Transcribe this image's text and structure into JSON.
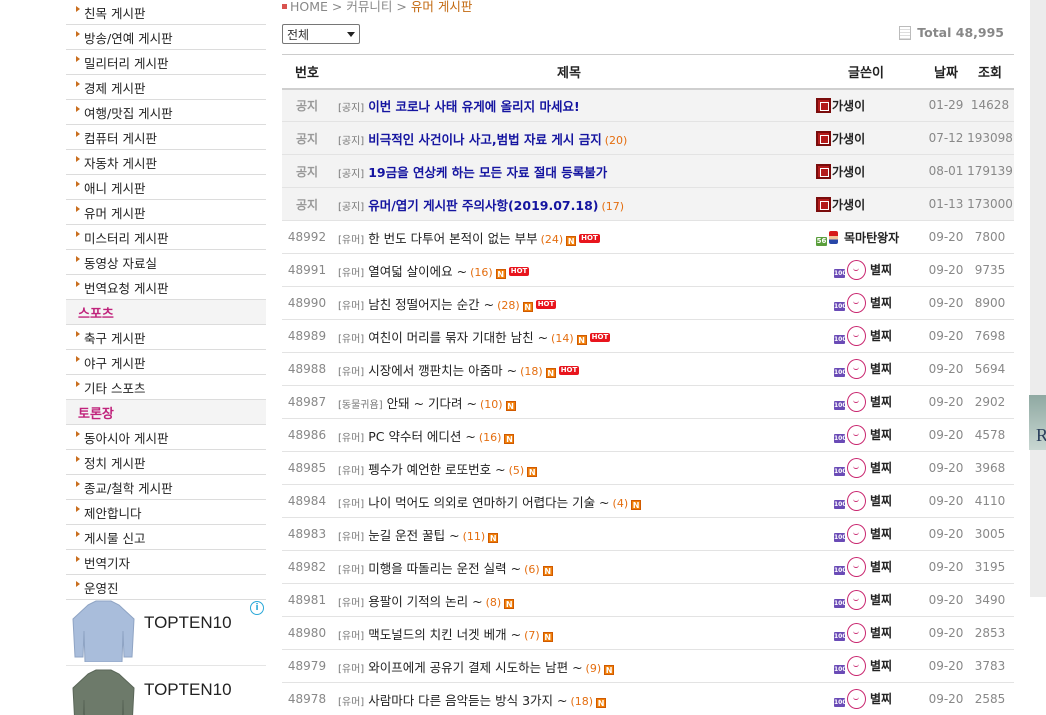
{
  "sidebar": {
    "items": [
      {
        "type": "item",
        "label": "친목 게시판"
      },
      {
        "type": "item",
        "label": "방송/연예 게시판"
      },
      {
        "type": "item",
        "label": "밀리터리 게시판"
      },
      {
        "type": "item",
        "label": "경제 게시판"
      },
      {
        "type": "item",
        "label": "여행/맛집 게시판"
      },
      {
        "type": "item",
        "label": "컴퓨터 게시판"
      },
      {
        "type": "item",
        "label": "자동차 게시판"
      },
      {
        "type": "item",
        "label": "애니 게시판"
      },
      {
        "type": "item",
        "label": "유머 게시판"
      },
      {
        "type": "item",
        "label": "미스터리 게시판"
      },
      {
        "type": "item",
        "label": "동영상 자료실"
      },
      {
        "type": "item",
        "label": "번역요청 게시판"
      },
      {
        "type": "category",
        "label": "스포츠"
      },
      {
        "type": "item",
        "label": "축구 게시판"
      },
      {
        "type": "item",
        "label": "야구 게시판"
      },
      {
        "type": "item",
        "label": "기타 스포츠"
      },
      {
        "type": "category",
        "label": "토론장"
      },
      {
        "type": "item",
        "label": "동아시아 게시판"
      },
      {
        "type": "item",
        "label": "정치 게시판"
      },
      {
        "type": "item",
        "label": "종교/철학 게시판"
      },
      {
        "type": "item",
        "label": "제안합니다"
      },
      {
        "type": "item",
        "label": "게시물 신고"
      },
      {
        "type": "item",
        "label": "번역기자"
      },
      {
        "type": "item",
        "label": "운영진"
      }
    ]
  },
  "ads": {
    "items": [
      {
        "label": "TOPTEN10",
        "color": "#a9bddb"
      },
      {
        "label": "TOPTEN10",
        "color": "#6d7a6a"
      }
    ]
  },
  "breadcrumb": {
    "home": "HOME",
    "section": "커뮤니티",
    "current": "유머 게시판",
    "separator": ">"
  },
  "filter": {
    "selected": "전체"
  },
  "total": {
    "label": "Total",
    "count": "48,995"
  },
  "table": {
    "headers": {
      "num": "번호",
      "subject": "제목",
      "author": "글쓴이",
      "date": "날짜",
      "views": "조회"
    },
    "rows": [
      {
        "num": "공지",
        "notice": true,
        "category": "[공지]",
        "title": "이번 코로나 사태 유게에 올리지 마세요!",
        "comments": "",
        "new": false,
        "hot": false,
        "author": "가생이",
        "author_icon": "admin-icon",
        "date": "01-29",
        "views": "14628"
      },
      {
        "num": "공지",
        "notice": true,
        "category": "[공지]",
        "title": "비극적인 사건이나 사고,범법 자료 게시 금지",
        "comments": "(20)",
        "new": false,
        "hot": false,
        "author": "가생이",
        "author_icon": "admin-icon",
        "date": "07-12",
        "views": "193098"
      },
      {
        "num": "공지",
        "notice": true,
        "category": "[공지]",
        "title": "19금을 연상케 하는 모든 자료 절대 등록불가",
        "comments": "",
        "new": false,
        "hot": false,
        "author": "가생이",
        "author_icon": "admin-icon",
        "date": "08-01",
        "views": "179139"
      },
      {
        "num": "공지",
        "notice": true,
        "category": "[공지]",
        "title": "유머/엽기 게시판 주의사항(2019.07.18)",
        "comments": "(17)",
        "new": false,
        "hot": false,
        "author": "가생이",
        "author_icon": "admin-icon",
        "date": "01-13",
        "views": "173000"
      },
      {
        "num": "48992",
        "notice": false,
        "category": "[유머]",
        "title": "한 번도 다투어 본적이 없는 부부",
        "comments": "(24)",
        "new": true,
        "hot": true,
        "author": "목마탄왕자",
        "author_icon": "mario-icon",
        "date": "09-20",
        "views": "7800"
      },
      {
        "num": "48991",
        "notice": false,
        "category": "[유머]",
        "title": "열여덟 살이에요 ~",
        "comments": "(16)",
        "new": true,
        "hot": true,
        "author": "별찌",
        "author_icon": "mascot-icon",
        "date": "09-20",
        "views": "9735"
      },
      {
        "num": "48990",
        "notice": false,
        "category": "[유머]",
        "title": "남친 정떨어지는 순간 ~",
        "comments": "(28)",
        "new": true,
        "hot": true,
        "author": "별찌",
        "author_icon": "mascot-icon",
        "date": "09-20",
        "views": "8900"
      },
      {
        "num": "48989",
        "notice": false,
        "category": "[유머]",
        "title": "여친이 머리를 묶자 기대한 남친 ~",
        "comments": "(14)",
        "new": true,
        "hot": true,
        "author": "별찌",
        "author_icon": "mascot-icon",
        "date": "09-20",
        "views": "7698"
      },
      {
        "num": "48988",
        "notice": false,
        "category": "[유머]",
        "title": "시장에서 깽판치는 아줌마 ~",
        "comments": "(18)",
        "new": true,
        "hot": true,
        "author": "별찌",
        "author_icon": "mascot-icon",
        "date": "09-20",
        "views": "5694"
      },
      {
        "num": "48987",
        "notice": false,
        "category": "[동물귀욤]",
        "title": "안돼 ~ 기다려 ~",
        "comments": "(10)",
        "new": true,
        "hot": false,
        "author": "별찌",
        "author_icon": "mascot-icon",
        "date": "09-20",
        "views": "2902"
      },
      {
        "num": "48986",
        "notice": false,
        "category": "[유머]",
        "title": "PC 약수터 에디션 ~",
        "comments": "(16)",
        "new": true,
        "hot": false,
        "author": "별찌",
        "author_icon": "mascot-icon",
        "date": "09-20",
        "views": "4578"
      },
      {
        "num": "48985",
        "notice": false,
        "category": "[유머]",
        "title": "펭수가 예언한 로또번호 ~",
        "comments": "(5)",
        "new": true,
        "hot": false,
        "author": "별찌",
        "author_icon": "mascot-icon",
        "date": "09-20",
        "views": "3968"
      },
      {
        "num": "48984",
        "notice": false,
        "category": "[유머]",
        "title": "나이 먹어도 의외로 연마하기 어렵다는 기술 ~",
        "comments": "(4)",
        "new": true,
        "hot": false,
        "author": "별찌",
        "author_icon": "mascot-icon",
        "date": "09-20",
        "views": "4110"
      },
      {
        "num": "48983",
        "notice": false,
        "category": "[유머]",
        "title": "눈길 운전 꿀팁 ~",
        "comments": "(11)",
        "new": true,
        "hot": false,
        "author": "별찌",
        "author_icon": "mascot-icon",
        "date": "09-20",
        "views": "3005"
      },
      {
        "num": "48982",
        "notice": false,
        "category": "[유머]",
        "title": "미행을 따돌리는 운전 실력 ~",
        "comments": "(6)",
        "new": true,
        "hot": false,
        "author": "별찌",
        "author_icon": "mascot-icon",
        "date": "09-20",
        "views": "3195"
      },
      {
        "num": "48981",
        "notice": false,
        "category": "[유머]",
        "title": "용팔이 기적의 논리 ~",
        "comments": "(8)",
        "new": true,
        "hot": false,
        "author": "별찌",
        "author_icon": "mascot-icon",
        "date": "09-20",
        "views": "3490"
      },
      {
        "num": "48980",
        "notice": false,
        "category": "[유머]",
        "title": "맥도널드의 치킨 너겟 베개 ~",
        "comments": "(7)",
        "new": true,
        "hot": false,
        "author": "별찌",
        "author_icon": "mascot-icon",
        "date": "09-20",
        "views": "2853"
      },
      {
        "num": "48979",
        "notice": false,
        "category": "[유머]",
        "title": "와이프에게 공유기 결제 시도하는 남편 ~",
        "comments": "(9)",
        "new": true,
        "hot": false,
        "author": "별찌",
        "author_icon": "mascot-icon",
        "date": "09-20",
        "views": "3783"
      },
      {
        "num": "48978",
        "notice": false,
        "category": "[유머]",
        "title": "사람마다 다른 음악듣는 방식 3가지 ~",
        "comments": "(18)",
        "new": true,
        "hot": false,
        "author": "별찌",
        "author_icon": "mascot-icon",
        "date": "09-20",
        "views": "2585"
      }
    ]
  },
  "icons": {
    "new_badge": "N",
    "hot_badge": "HOT",
    "level_badge": "100",
    "level_badge_alt": "56"
  },
  "colors": {
    "notice_title": "#1414a0",
    "comment_count": "#e46e10",
    "category_header": "#c0237c",
    "hot": "#e8151d"
  }
}
